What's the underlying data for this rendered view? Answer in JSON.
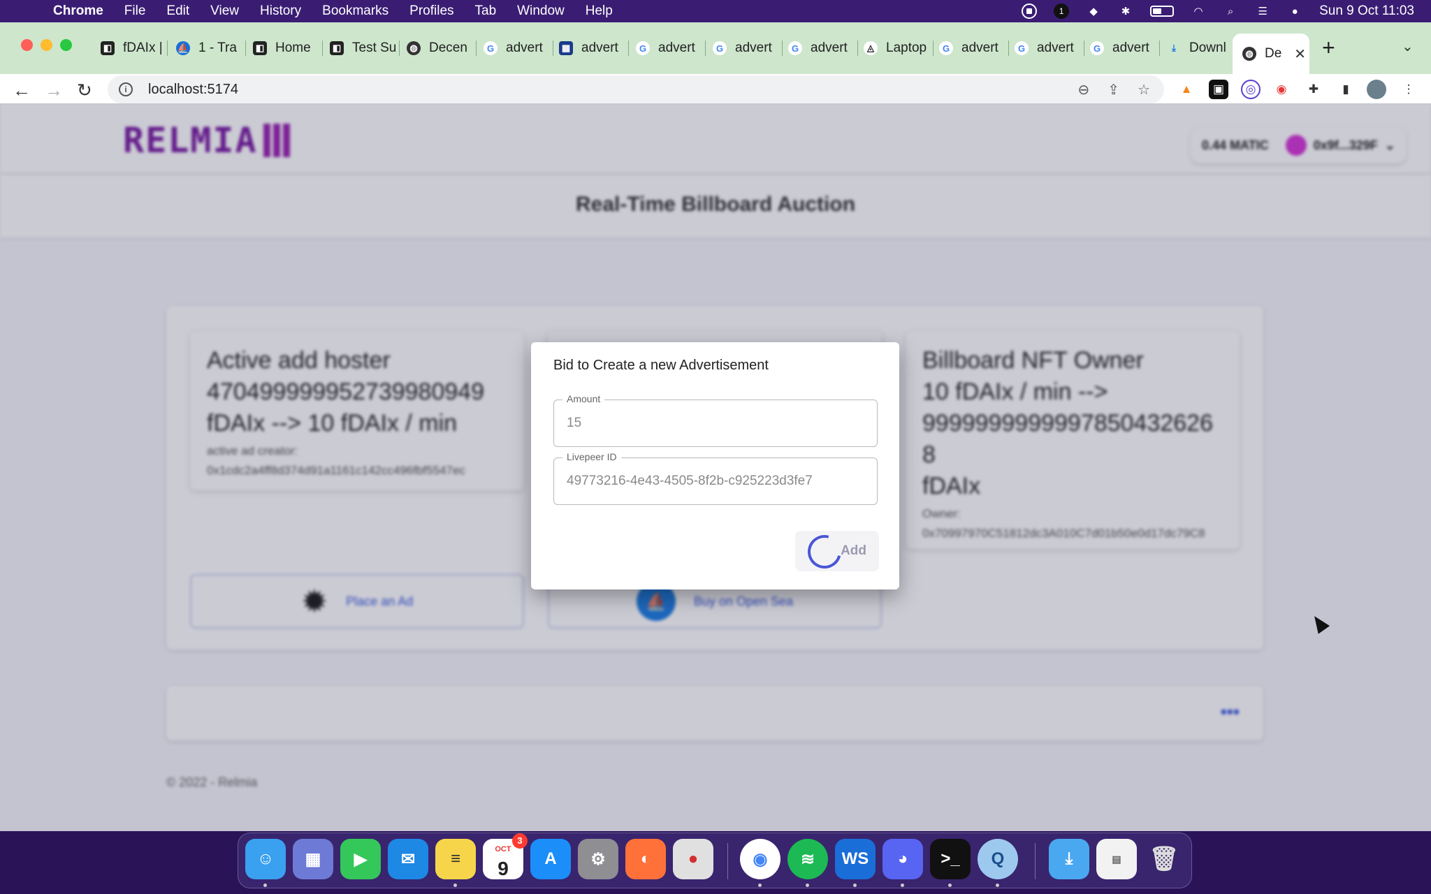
{
  "menubar": {
    "app": "Chrome",
    "items": [
      "File",
      "Edit",
      "View",
      "History",
      "Bookmarks",
      "Profiles",
      "Tab",
      "Window",
      "Help"
    ],
    "notification_count": "1",
    "clock": "Sun 9 Oct  11:03"
  },
  "tabs": [
    {
      "label": "fDAIx |",
      "icon": "fdaix-favicon"
    },
    {
      "label": "1 - Tra",
      "icon": "transak-favicon"
    },
    {
      "label": "Home",
      "icon": "home-favicon"
    },
    {
      "label": "Test Su",
      "icon": "test-favicon"
    },
    {
      "label": "Decen",
      "icon": "globe-favicon"
    },
    {
      "label": "advert",
      "icon": "google-favicon"
    },
    {
      "label": "advert",
      "icon": "site-favicon"
    },
    {
      "label": "advert",
      "icon": "google-favicon"
    },
    {
      "label": "advert",
      "icon": "google-favicon"
    },
    {
      "label": "advert",
      "icon": "google-favicon"
    },
    {
      "label": "Laptop",
      "icon": "laptop-favicon"
    },
    {
      "label": "advert",
      "icon": "google-favicon"
    },
    {
      "label": "advert",
      "icon": "google-favicon"
    },
    {
      "label": "advert",
      "icon": "google-favicon"
    },
    {
      "label": "Downl",
      "icon": "download-favicon"
    },
    {
      "label": "De",
      "icon": "globe-favicon",
      "active": true
    }
  ],
  "omnibox": {
    "url": "localhost:5174"
  },
  "app": {
    "logo": "RELMIA",
    "wallet": {
      "balance": "0.44 MATIC",
      "address": "0x9f...329F"
    },
    "page_title": "Real-Time Billboard Auction",
    "left_card": {
      "line1": "Active add hoster",
      "line2": "470499999952739980949",
      "line3": "fDAIx --> 10 fDAIx / min",
      "creator_label": "active ad creator:",
      "creator_addr": "0x1cdc2a4ff8d374d91a1161c142cc496fbf5547ec"
    },
    "right_card": {
      "line1": "Billboard NFT Owner",
      "line2": "10 fDAIx / min -->",
      "line3": "9999999999997850432626​8",
      "line4": "fDAIx",
      "owner_label": "Owner:",
      "owner_addr": "0x70997970C51812dc3A010C7d01b50e0d17dc79C8"
    },
    "place_ad_label": "Place an Ad",
    "opensea_label": "Buy on Open Sea",
    "more_label": "•••",
    "footer": "© 2022 - Relmia"
  },
  "dialog": {
    "title": "Bid to Create a new Advertisement",
    "amount_label": "Amount",
    "amount_value": "15",
    "livepeer_label": "Livepeer ID",
    "livepeer_value": "49773216-4e43-4505-8f2b-c925223d3fe7",
    "add_label": "Add"
  },
  "dock": {
    "calendar_month": "OCT",
    "calendar_day": "9",
    "calendar_badge": "3"
  }
}
